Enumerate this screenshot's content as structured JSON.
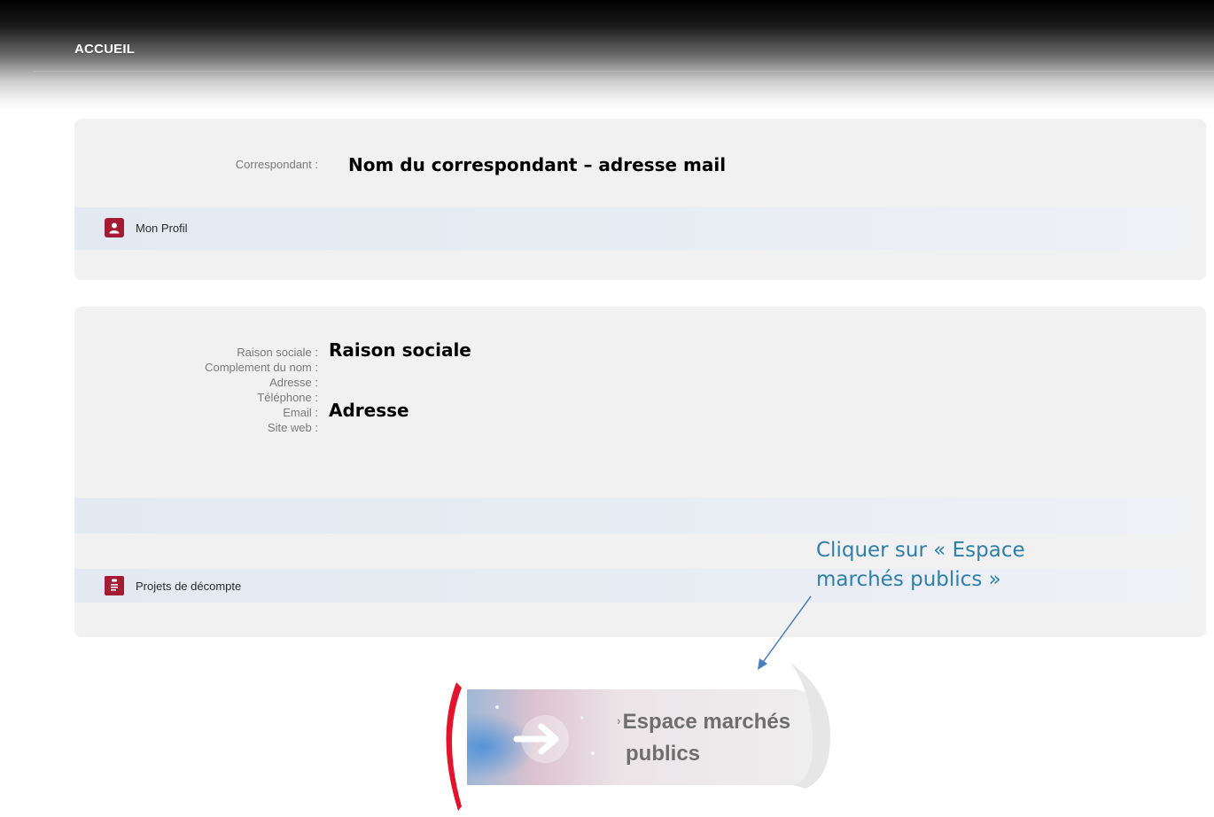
{
  "header": {
    "title": "ACCUEIL"
  },
  "correspondant_panel": {
    "label": "Correspondant :",
    "value": "Nom du correspondant – adresse mail",
    "profile_link": "Mon Profil"
  },
  "company_panel": {
    "fields": [
      {
        "label": "Raison sociale :"
      },
      {
        "label": "Complement du nom :"
      },
      {
        "label": "Adresse :"
      },
      {
        "label": "Téléphone :"
      },
      {
        "label": "Email :"
      },
      {
        "label": "Site web :"
      }
    ],
    "raison_sociale_value": "Raison sociale",
    "adresse_value": "Adresse",
    "decompte_link": "Projets de décompte"
  },
  "annotation": {
    "line1": "Cliquer sur « Espace",
    "line2": "marchés publics »",
    "color": "#2f7fa8"
  },
  "marches_button": {
    "bullet": "›",
    "line1": "Espace marchés",
    "line2": "publics"
  },
  "colors": {
    "accent_red": "#a41b34",
    "panel_bg": "#f1f1f2"
  }
}
